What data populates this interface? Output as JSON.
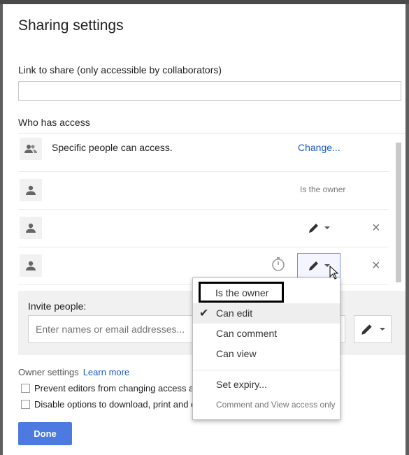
{
  "dialog": {
    "title": "Sharing settings",
    "link_label": "Link to share (only accessible by collaborators)",
    "link_value": "",
    "who_has_access_label": "Who has access"
  },
  "access_rows": [
    {
      "text": "Specific people can access.",
      "action": "Change...",
      "icon": "people-icon"
    },
    {
      "text": "",
      "status": "Is the owner",
      "icon": "person-icon"
    },
    {
      "text": "",
      "permission_icon": "pencil-icon",
      "icon": "person-icon"
    },
    {
      "text": "",
      "permission_icon": "pencil-icon",
      "expiry_icon": "timer-icon",
      "icon": "person-icon"
    }
  ],
  "invite": {
    "label": "Invite people:",
    "placeholder": "Enter names or email addresses..."
  },
  "owner_settings": {
    "label": "Owner settings",
    "learn_more": "Learn more",
    "options": [
      {
        "label": "Prevent editors from changing access a",
        "checked": false
      },
      {
        "label": "Disable options to download, print and c",
        "checked": false
      }
    ]
  },
  "done_label": "Done",
  "permission_menu": {
    "items": [
      {
        "label": "Is the owner",
        "highlighted": true
      },
      {
        "label": "Can edit",
        "checked": true
      },
      {
        "label": "Can comment"
      },
      {
        "label": "Can view"
      }
    ],
    "set_expiry": "Set expiry...",
    "note": "Comment and View access only"
  },
  "colors": {
    "accent": "#4d7ae0",
    "link": "#1a5bc4"
  }
}
